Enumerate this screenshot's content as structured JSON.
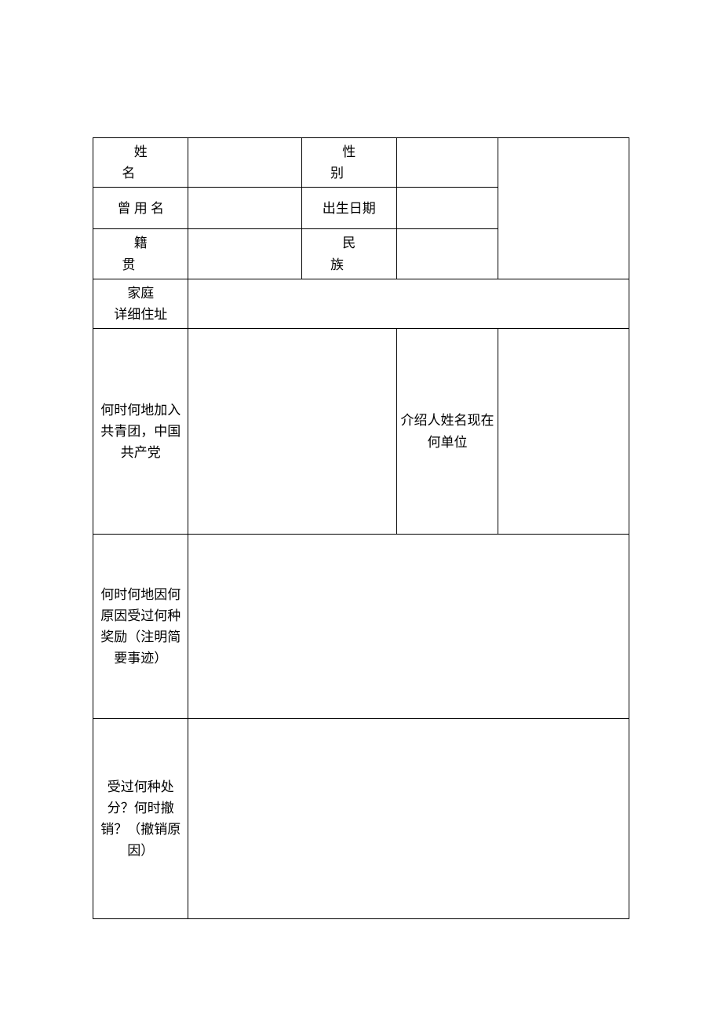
{
  "labels": {
    "name": "姓名",
    "gender": "性别",
    "former_name": "曾 用 名",
    "birth_date": "出生日期",
    "native_place": "籍贯",
    "ethnicity": "民族",
    "address": "家庭\n详细住址",
    "party_join": "何时何地加入共青团，中国共产党",
    "introducer": "介绍人姓名现在何单位",
    "awards": "何时何地因何原因受过何种奖励（注明简要事迹）",
    "punishments": "受过何种处分？何时撤销？（撤销原因）"
  },
  "values": {
    "name": "",
    "gender": "",
    "former_name": "",
    "birth_date": "",
    "native_place": "",
    "ethnicity": "",
    "address": "",
    "party_join": "",
    "introducer": "",
    "awards": "",
    "punishments": "",
    "photo": ""
  }
}
